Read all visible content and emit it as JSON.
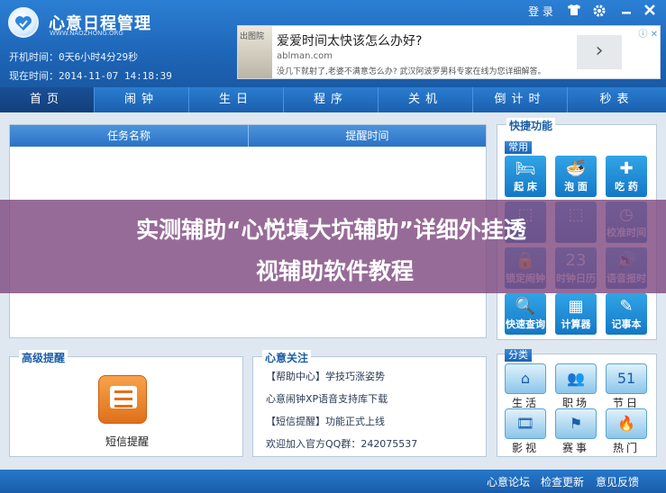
{
  "app": {
    "title": "心意日程管理",
    "url": "WWW.NAOZHONG.ORG",
    "boot_time_label": "开机时间：",
    "boot_time_value": "0天6小时4分29秒",
    "now_label": "现在时间：",
    "now_value": "2014-11-07  14:18:39"
  },
  "titlebar": {
    "login_label": "登 录",
    "skin_icon": "tshirt-icon",
    "settings_icon": "gear-icon",
    "minimize_icon": "minimize-icon",
    "close_icon": "close-icon"
  },
  "ad": {
    "image_text": "出图院",
    "title": "爱爱时间太快该怎么办好?",
    "domain": "ablman.com",
    "desc": "没几下就射了,老婆不满意怎么办? 武汉阿波罗男科专家在线为您详细解答。",
    "arrow": "›",
    "corner": "ⓘ ✕"
  },
  "nav": {
    "tabs": [
      {
        "label": "首页",
        "active": true
      },
      {
        "label": "闹钟",
        "active": false
      },
      {
        "label": "生日",
        "active": false
      },
      {
        "label": "程序",
        "active": false
      },
      {
        "label": "关机",
        "active": false
      },
      {
        "label": "倒计时",
        "active": false
      },
      {
        "label": "秒表",
        "active": false
      }
    ]
  },
  "task_table": {
    "columns": [
      "任务名称",
      "提醒时间"
    ],
    "rows": []
  },
  "advanced": {
    "title": "高级提醒",
    "sms_label": "短信提醒"
  },
  "care": {
    "title": "心意关注",
    "items": [
      "【帮助中心】学技巧涨姿势",
      "心意闹钟XP语音支持库下载",
      "【短信提醒】功能正式上线",
      "欢迎加入官方QQ群：242075537"
    ]
  },
  "quick": {
    "title": "快捷功能",
    "group_label": "常用",
    "items": [
      {
        "label": "起 床",
        "icon": "bed-icon",
        "glyph": "🛏"
      },
      {
        "label": "泡 面",
        "icon": "noodle-bowl-icon",
        "glyph": "🍜"
      },
      {
        "label": "吃 药",
        "icon": "medicine-kit-icon",
        "glyph": "✚"
      },
      {
        "label": "",
        "icon": "unknown-icon",
        "glyph": "⬚"
      },
      {
        "label": "",
        "icon": "unknown-icon",
        "glyph": "⬚"
      },
      {
        "label": "校准时间",
        "icon": "calibrate-time-icon",
        "glyph": "◷"
      },
      {
        "label": "锁定闹钟",
        "icon": "lock-icon",
        "glyph": "🔒"
      },
      {
        "label": "时钟日历",
        "icon": "calendar-icon",
        "glyph": "23"
      },
      {
        "label": "语音报时",
        "icon": "speaker-icon",
        "glyph": "🔊"
      },
      {
        "label": "快速查询",
        "icon": "search-icon",
        "glyph": "🔍"
      },
      {
        "label": "计算器",
        "icon": "calculator-icon",
        "glyph": "▦"
      },
      {
        "label": "记事本",
        "icon": "notepad-icon",
        "glyph": "✎"
      }
    ]
  },
  "category": {
    "group_label": "分类",
    "items": [
      {
        "label": "生活",
        "icon": "house-icon",
        "glyph": "⌂"
      },
      {
        "label": "职场",
        "icon": "people-icon",
        "glyph": "👥"
      },
      {
        "label": "节日",
        "icon": "calendar-51-icon",
        "glyph": "51"
      },
      {
        "label": "影视",
        "icon": "film-reel-icon",
        "glyph": "🎞"
      },
      {
        "label": "赛事",
        "icon": "flags-icon",
        "glyph": "⚑"
      },
      {
        "label": "热门",
        "icon": "flame-icon",
        "glyph": "🔥"
      }
    ]
  },
  "footer": {
    "links": [
      "心意论坛",
      "检查更新",
      "意见反馈"
    ]
  },
  "overlay": {
    "line1": "实测辅助“心悦填大坑辅助”详细外挂透",
    "line2": "视辅助软件教程"
  }
}
